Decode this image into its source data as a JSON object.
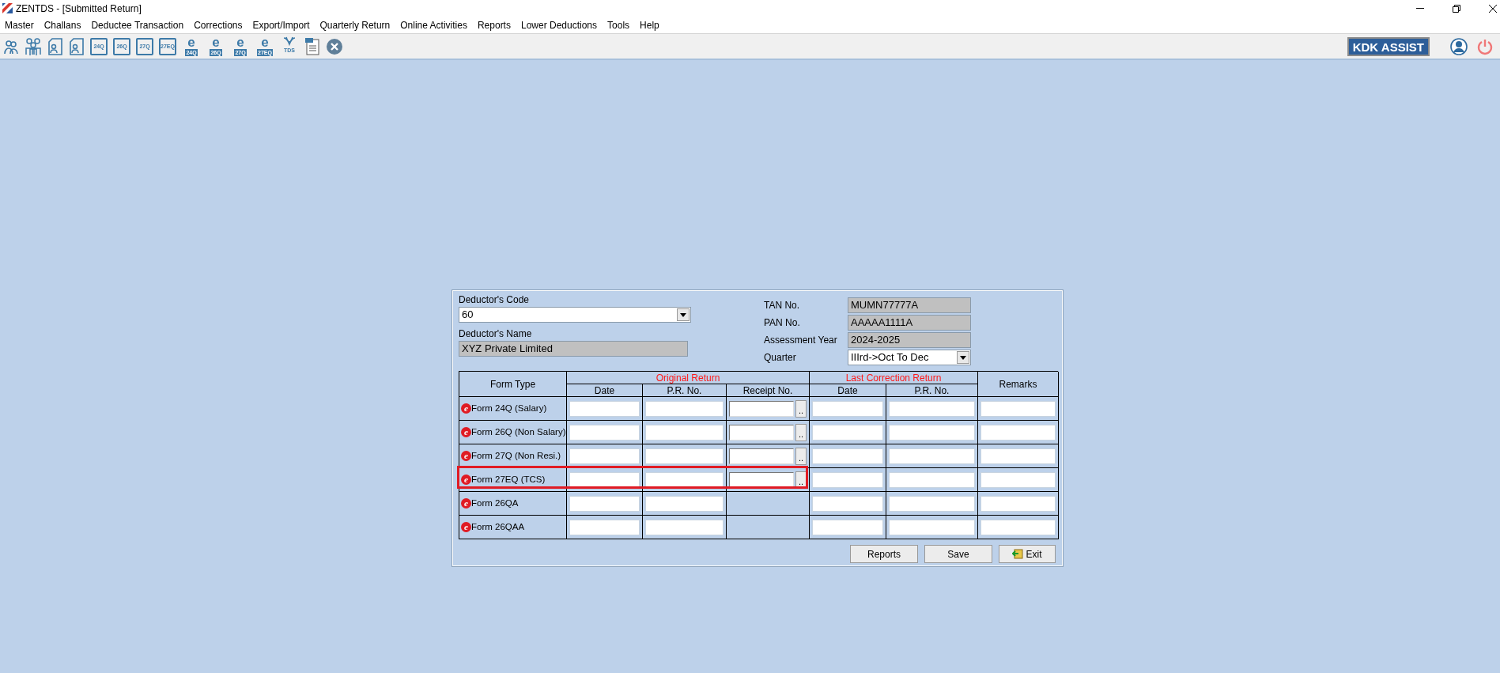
{
  "window": {
    "title": "ZENTDS - [Submitted Return]"
  },
  "menu": [
    "Master",
    "Challans",
    "Deductee Transaction",
    "Corrections",
    "Export/Import",
    "Quarterly Return",
    "Online Activities",
    "Reports",
    "Lower Deductions",
    "Tools",
    "Help"
  ],
  "toolbar": [
    {
      "kind": "person"
    },
    {
      "kind": "group"
    },
    {
      "kind": "doc-person"
    },
    {
      "kind": "doc-person"
    },
    {
      "kind": "form",
      "label": "24Q"
    },
    {
      "kind": "form",
      "label": "26Q"
    },
    {
      "kind": "form",
      "label": "27Q"
    },
    {
      "kind": "form",
      "label": "27EQ"
    },
    {
      "kind": "eform",
      "glyph": "e",
      "label": "24Q"
    },
    {
      "kind": "eform",
      "glyph": "e",
      "label": "26Q"
    },
    {
      "kind": "eform",
      "glyph": "e",
      "label": "27Q"
    },
    {
      "kind": "eform",
      "glyph": "e",
      "label": "27EQ"
    },
    {
      "kind": "tds",
      "label": "TDS"
    },
    {
      "kind": "pdf"
    },
    {
      "kind": "close"
    }
  ],
  "assist_button": "KDK ASSIST",
  "form": {
    "deductor_code": {
      "label": "Deductor's Code",
      "value": "60"
    },
    "deductor_name": {
      "label": "Deductor's Name",
      "value": "XYZ Private Limited"
    },
    "tan": {
      "label": "TAN No.",
      "value": "MUMN77777A"
    },
    "pan": {
      "label": "PAN No.",
      "value": "AAAAA1111A"
    },
    "assessment_year": {
      "label": "Assessment Year",
      "value": "2024-2025"
    },
    "quarter": {
      "label": "Quarter",
      "value": "IIIrd->Oct To Dec"
    },
    "table": {
      "form_type_header": "Form Type",
      "original_header": "Original Return",
      "last_correction_header": "Last Correction Return",
      "remarks_header": "Remarks",
      "sub_headers": [
        "Date",
        "P.R. No.",
        "Receipt No.",
        "Date",
        "P.R. No."
      ],
      "browse_label": "..",
      "rows": [
        {
          "icon_glyph": "e",
          "form": "Form 24Q (Salary)",
          "receipt": true,
          "highlighted": false
        },
        {
          "icon_glyph": "e",
          "form": "Form 26Q (Non Salary)",
          "receipt": true,
          "highlighted": false
        },
        {
          "icon_glyph": "e",
          "form": "Form 27Q (Non Resi.)",
          "receipt": true,
          "highlighted": false
        },
        {
          "icon_glyph": "e",
          "form": "Form 27EQ (TCS)",
          "receipt": true,
          "highlighted": true
        },
        {
          "icon_glyph": "e",
          "form": "Form 26QA",
          "receipt": false,
          "highlighted": false
        },
        {
          "icon_glyph": "e",
          "form": "Form 26QAA",
          "receipt": false,
          "highlighted": false
        }
      ]
    },
    "buttons": [
      {
        "kind": "plain",
        "label": "Reports"
      },
      {
        "kind": "plain",
        "label": "Save"
      },
      {
        "kind": "exit",
        "label": "Exit"
      }
    ]
  }
}
